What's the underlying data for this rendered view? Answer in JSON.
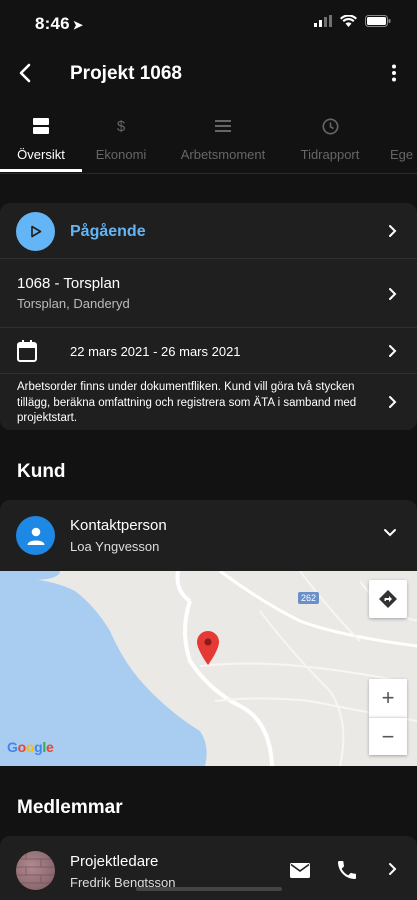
{
  "status_bar": {
    "time": "8:46"
  },
  "header": {
    "title": "Projekt 1068"
  },
  "tabs": [
    {
      "label": "Översikt",
      "icon": "overview-icon",
      "active": true
    },
    {
      "label": "Ekonomi",
      "icon": "dollar-icon",
      "active": false
    },
    {
      "label": "Arbetsmoment",
      "icon": "list-icon",
      "active": false
    },
    {
      "label": "Tidrapport",
      "icon": "clock-icon",
      "active": false
    },
    {
      "label": "Ege",
      "icon": "",
      "active": false
    }
  ],
  "overview": {
    "status": "Pågående",
    "project_title": "1068 - Torsplan",
    "project_address": "Torsplan, Danderyd",
    "date_range": "22 mars 2021 - 26 mars 2021",
    "description": "Arbetsorder finns under dokumentfliken. Kund vill göra två stycken tillägg, beräkna omfattning och registrera som ÄTA i samband med projektstart."
  },
  "customer": {
    "section_title": "Kund",
    "contact_label": "Kontaktperson",
    "contact_name": "Loa Yngvesson"
  },
  "map": {
    "road_number": "262",
    "attribution": "Google",
    "zoom_in": "+",
    "zoom_out": "−"
  },
  "members": {
    "section_title": "Medlemmar",
    "role": "Projektledare",
    "name": "Fredrik Bengtsson"
  },
  "colors": {
    "accent": "#64b5f6",
    "contact_avatar": "#1e88e5",
    "background": "#121212",
    "card": "#1f1f1f"
  }
}
